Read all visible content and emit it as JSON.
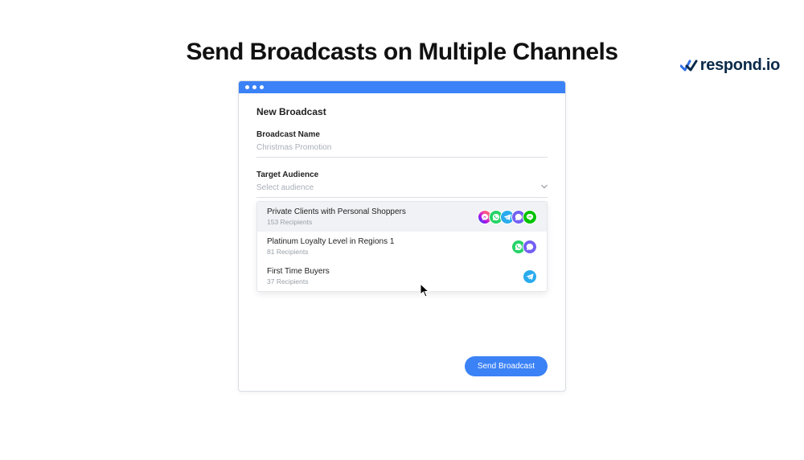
{
  "brand": {
    "name": "respond.io"
  },
  "page": {
    "heading": "Send Broadcasts on Multiple Channels"
  },
  "window": {
    "title": "New Broadcast",
    "name_field": {
      "label": "Broadcast Name",
      "value": "Christmas Promotion"
    },
    "audience_field": {
      "label": "Target Audience",
      "placeholder": "Select audience"
    },
    "options": [
      {
        "name": "Private Clients with Personal Shoppers",
        "recipients": "153 Recipients",
        "channels": [
          "messenger",
          "whatsapp",
          "telegram",
          "viber",
          "line"
        ],
        "hovered": true
      },
      {
        "name": "Platinum Loyalty Level in Regions 1",
        "recipients": "81 Recipients",
        "channels": [
          "whatsapp",
          "viber"
        ],
        "hovered": false
      },
      {
        "name": "First Time Buyers",
        "recipients": "37 Recipients",
        "channels": [
          "telegram"
        ],
        "hovered": false
      }
    ],
    "submit_label": "Send Broadcast"
  },
  "channel_icons": {
    "messenger": "messenger-icon",
    "whatsapp": "whatsapp-icon",
    "telegram": "telegram-icon",
    "viber": "viber-icon",
    "line": "line-icon"
  }
}
